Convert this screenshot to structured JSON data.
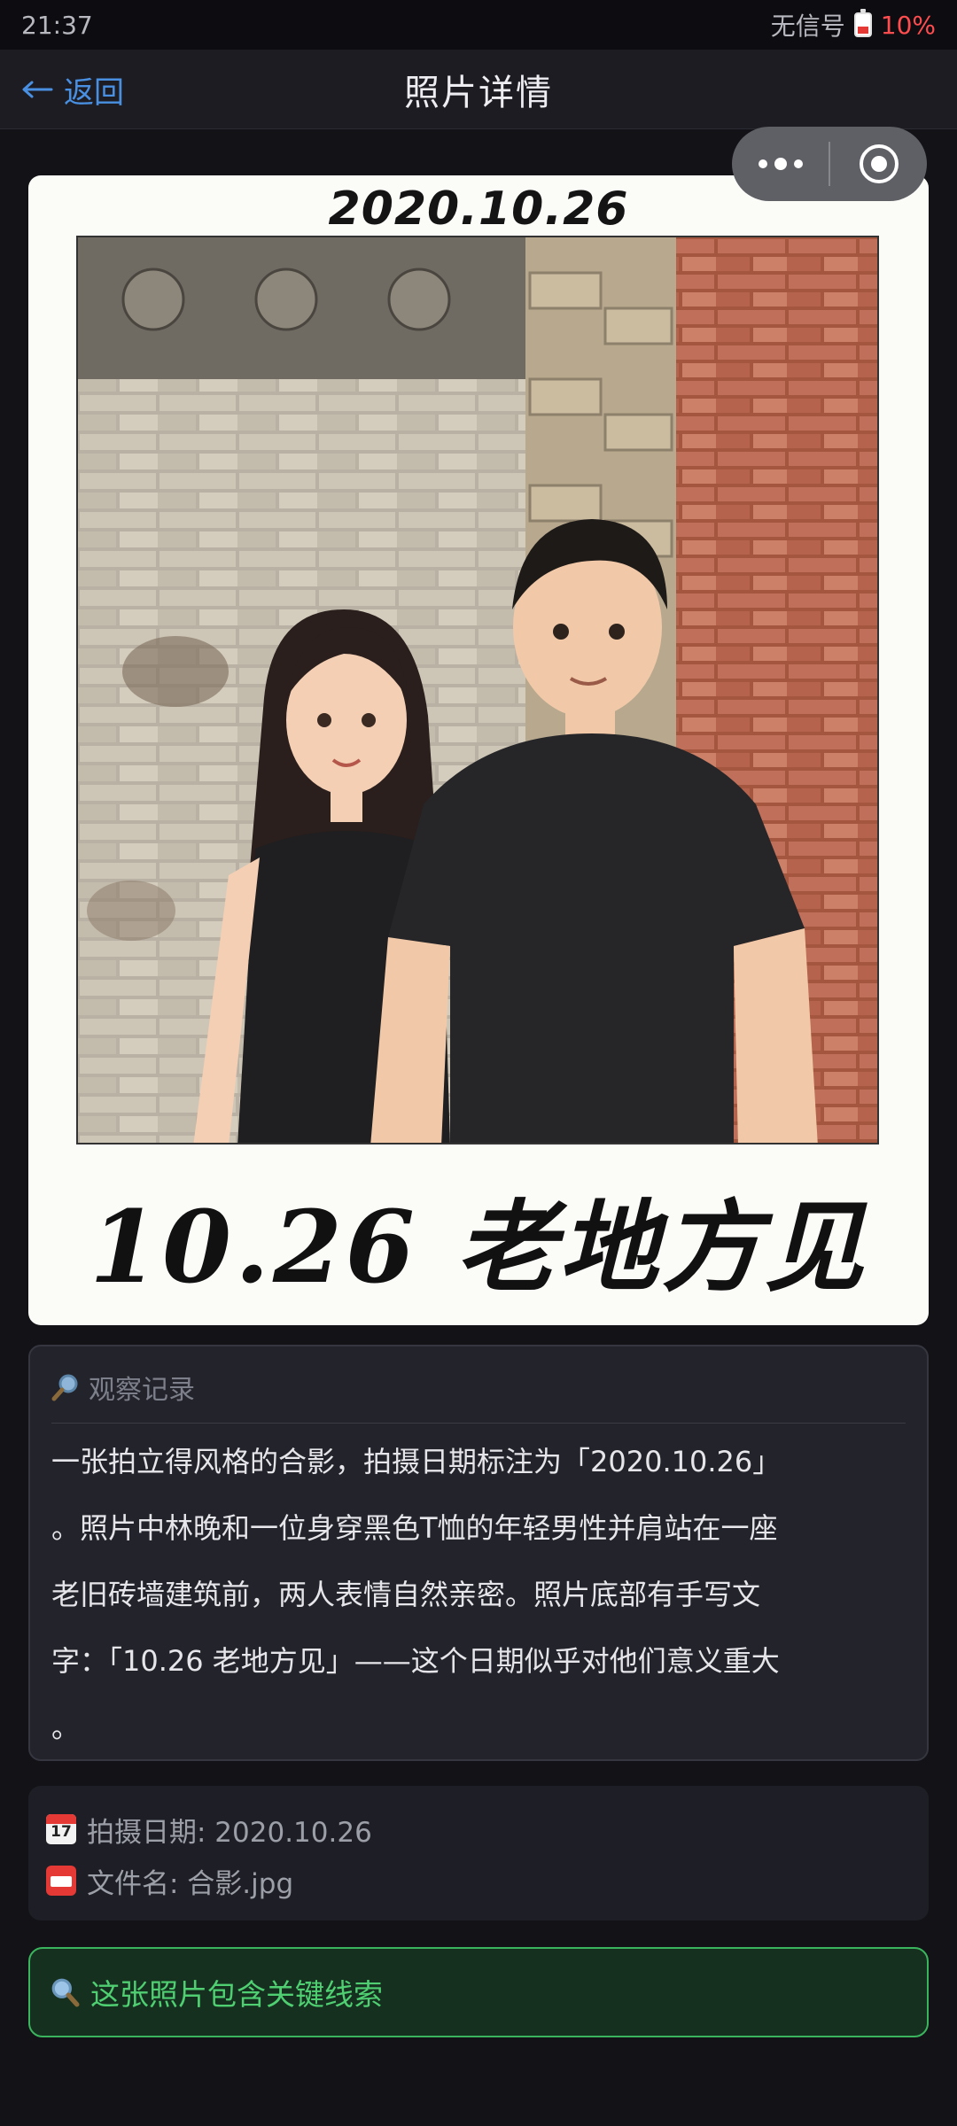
{
  "status_bar": {
    "time": "21:37",
    "signal": "无信号",
    "battery": "10%"
  },
  "nav": {
    "back_label": "返回",
    "title": "照片详情"
  },
  "photo": {
    "date_text": "2020.10.26",
    "caption_text": "10.26 老地方见"
  },
  "observation": {
    "header": "观察记录",
    "lines": [
      "一张拍立得风格的合影，拍摄日期标注为「2020.10.26」",
      "。照片中林晚和一位身穿黑色T恤的年轻男性并肩站在一座",
      "老旧砖墙建筑前，两人表情自然亲密。照片底部有手写文",
      "字：「10.26 老地方见」——这个日期似乎对他们意义重大",
      "。"
    ]
  },
  "meta": {
    "date_label": "拍摄日期: 2020.10.26",
    "file_label": "文件名: 合影.jpg",
    "calendar_day": "17"
  },
  "clue": {
    "label": "这张照片包含关键线索"
  },
  "colors": {
    "accent_blue": "#4a90e2",
    "clue_green": "#4fcf72",
    "battery_red": "#ff4d4f"
  }
}
